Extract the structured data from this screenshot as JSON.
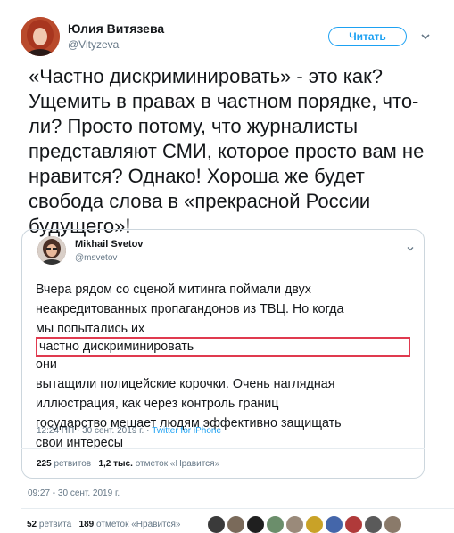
{
  "author": {
    "name": "Юлия Витязева",
    "handle": "@Vityzeva"
  },
  "follow_button": {
    "label": "Читать"
  },
  "icons": {
    "chevron": "chevron-down-icon"
  },
  "tweet": {
    "lines": [
      "«Частно дискриминировать» - это как?",
      "Ущемить в правах в частном порядке, что-",
      "ли? Просто потому, что журналисты",
      "представляют СМИ, которое просто вам не",
      "нравится? Однако! Хороша же будет",
      "свобода слова в «прекрасной России",
      "будущего»!"
    ],
    "date": "09:27 - 30 сент. 2019 г.",
    "retweets_count": "52",
    "retweets_label": "ретвита",
    "likes_count": "189",
    "likes_label": "отметок «Нравится»"
  },
  "quoted": {
    "name": "Mikhail Svetov",
    "handle": "@msvetov",
    "line1": "Вчера рядом со сценой митинга поймали двух",
    "line2": "неакредитованных пропагандонов из ТВЦ. Но когда",
    "line3_before": "мы попытались их ",
    "line3_highlight": "частно дискриминировать",
    "line3_after": " они",
    "line4": "вытащили полицейские корочки. Очень наглядная",
    "line5": "иллюстрация, как через контроль границ",
    "line6": "государство мешает людям эффективно защищать",
    "line7": "свои интересы",
    "time": "12:24 ПП · 30 сент. 2019 г. · ",
    "source": "Twitter for iPhone",
    "retweets_count": "225",
    "retweets_label": "ретвитов",
    "likes_count": "1,2 тыс.",
    "likes_label": "отметок «Нравится»"
  },
  "colors": {
    "accent": "#1da1f2",
    "highlight_border": "#e03a4f",
    "muted": "#657786",
    "text": "#14171a"
  }
}
